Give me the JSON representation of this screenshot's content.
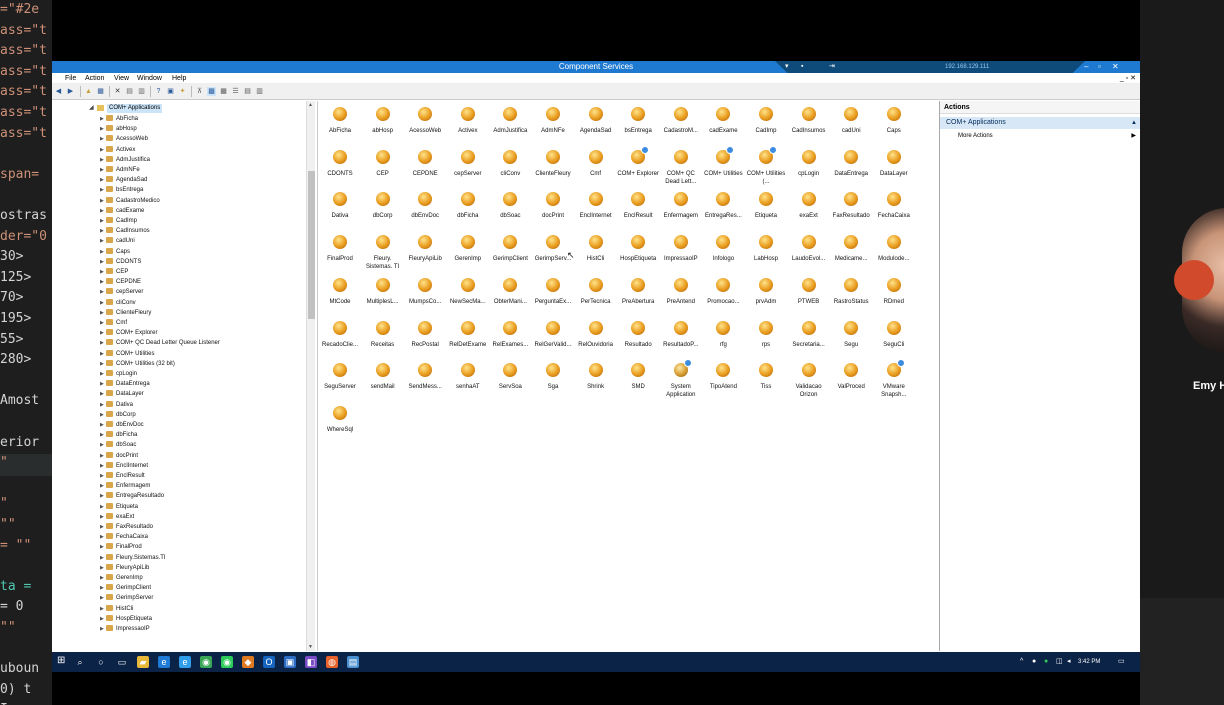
{
  "code_editor": {
    "lines": [
      {
        "text": "=\"#2e",
        "color": "#ce9178"
      },
      {
        "text": "ass=\"t",
        "color": "#ce9178"
      },
      {
        "text": "ass=\"t",
        "color": "#ce9178"
      },
      {
        "text": "ass=\"t",
        "color": "#ce9178"
      },
      {
        "text": "ass=\"t",
        "color": "#ce9178"
      },
      {
        "text": "ass=\"t",
        "color": "#ce9178"
      },
      {
        "text": "ass=\"t",
        "color": "#ce9178"
      },
      {
        "text": "",
        "color": "#d4d4d4"
      },
      {
        "text": "span=",
        "color": "#ce9178"
      },
      {
        "text": "",
        "color": "#d4d4d4"
      },
      {
        "text": "ostras",
        "color": "#d4d4d4"
      },
      {
        "text": "der=\"0",
        "color": "#ce9178"
      },
      {
        "text": "30>",
        "color": "#d4d4d4"
      },
      {
        "text": "125>",
        "color": "#d4d4d4"
      },
      {
        "text": "70>",
        "color": "#d4d4d4"
      },
      {
        "text": "195>",
        "color": "#d4d4d4"
      },
      {
        "text": "55>",
        "color": "#d4d4d4"
      },
      {
        "text": "280>",
        "color": "#d4d4d4"
      },
      {
        "text": "",
        "color": "#d4d4d4"
      },
      {
        "text": "Amost",
        "color": "#d4d4d4"
      },
      {
        "text": "",
        "color": "#d4d4d4"
      },
      {
        "text": "erior",
        "color": "#d4d4d4"
      },
      {
        "text": "\"",
        "color": "#ce9178"
      },
      {
        "text": "",
        "color": "#d4d4d4"
      },
      {
        "text": "\"",
        "color": "#ce9178"
      },
      {
        "text": " \"\"",
        "color": "#ce9178"
      },
      {
        "text": " = \"\"",
        "color": "#ce9178"
      },
      {
        "text": "",
        "color": "#d4d4d4"
      },
      {
        "text": "ta =",
        "color": "#4ec9b0"
      },
      {
        "text": "= 0",
        "color": "#d4d4d4"
      },
      {
        "text": "\"\"",
        "color": "#ce9178"
      },
      {
        "text": "",
        "color": "#d4d4d4"
      },
      {
        "text": "uboun",
        "color": "#d4d4d4"
      },
      {
        "text": " 0) t",
        "color": "#d4d4d4"
      },
      {
        "text": "I",
        "color": "#d4d4d4"
      }
    ]
  },
  "participant": {
    "name": "Emy H"
  },
  "window": {
    "title": "Component Services",
    "connection_ip": "192.168.129.111",
    "menu": [
      "File",
      "Action",
      "View",
      "Window",
      "Help"
    ]
  },
  "tree": {
    "root": "COM+ Applications",
    "items": [
      "AbFicha",
      "abHosp",
      "AcessoWeb",
      "Activex",
      "AdmJustifica",
      "AdmNFe",
      "AgendaSad",
      "bsEntrega",
      "CadastroMedico",
      "cadExame",
      "CadImp",
      "CadInsumos",
      "cadUni",
      "Caps",
      "CDONTS",
      "CEP",
      "CEPDNE",
      "cepServer",
      "cliConv",
      "ClienteFleury",
      "Cmf",
      "COM+ Explorer",
      "COM+ QC Dead Letter Queue Listener",
      "COM+ Utilities",
      "COM+ Utilities (32 bit)",
      "cpLogin",
      "DataEntrega",
      "DataLayer",
      "Dativa",
      "dbCorp",
      "dbEnvDoc",
      "dbFicha",
      "dbSoac",
      "docPrint",
      "EnclInternet",
      "EnclResult",
      "Enfermagem",
      "EntregaResultado",
      "Etiqueta",
      "exaExt",
      "FaxResultado",
      "FechaCaixa",
      "FinalProd",
      "Fleury.Sistemas.TI",
      "FleuryApiLib",
      "GerenImp",
      "GerimpClient",
      "GerimpServer",
      "HistCli",
      "HospEtiqueta",
      "ImpressaoIP"
    ]
  },
  "icons": [
    "AbFicha",
    "abHosp",
    "AcessoWeb",
    "Activex",
    "AdmJustifica",
    "AdmNFe",
    "AgendaSad",
    "bsEntrega",
    "CadastroM...",
    "cadExame",
    "CadImp",
    "CadInsumos",
    "cadUni",
    "Caps",
    "CDONTS",
    "CEP",
    "CEPDNE",
    "cepServer",
    "cliConv",
    "ClienteFleury",
    "Cmf",
    "COM+ Explorer",
    "COM+ QC Dead Lett...",
    "COM+ Utilities",
    "COM+ Utilities (...",
    "cpLogin",
    "DataEntrega",
    "DataLayer",
    "Dativa",
    "dbCorp",
    "dbEnvDoc",
    "dbFicha",
    "dbSoac",
    "docPrint",
    "EnclInternet",
    "EnclResult",
    "Enfermagem",
    "EntregaRes...",
    "Etiqueta",
    "exaExt",
    "FaxResultado",
    "FechaCaixa",
    "FinalProd",
    "Fleury. Sistemas. TI",
    "FleuryApiLib",
    "GerenImp",
    "GerimpClient",
    "GerimpServ...",
    "HistCli",
    "HospEtiqueta",
    "ImpressaoIP",
    "Infologo",
    "LabHosp",
    "LaudoEvol...",
    "Medicame...",
    "Modulode...",
    "MtCode",
    "MultiplesL...",
    "MumpsCo...",
    "NewSecMa...",
    "ObterMani...",
    "PerguntaEx...",
    "PerTecnica",
    "PreAbertura",
    "PreAntend",
    "Promocao...",
    "prvAdm",
    "PTWEB",
    "RastroStatus",
    "RDmed",
    "RecadoClie...",
    "Receitas",
    "RecPostal",
    "RelDetExame",
    "RelExames...",
    "RelGerValid...",
    "RelOuvidoria",
    "Resultado",
    "ResultadoP...",
    "rfg",
    "rps",
    "Secretaria...",
    "Segu",
    "SeguCli",
    "SeguServer",
    "sendMail",
    "SendMess...",
    "senhaAT",
    "ServSoa",
    "Sga",
    "Shrink",
    "SMD",
    "System Application",
    "TipoAtend",
    "Tiss",
    "Validacao Orizon",
    "ValProced",
    "VMware Snapsh...",
    "WhereSql"
  ],
  "badged_icons": [
    "COM+ Explorer",
    "COM+ Utilities",
    "COM+ Utilities (...",
    "System Application",
    "VMware Snapsh..."
  ],
  "actions": {
    "header": "Actions",
    "section": "COM+ Applications",
    "more": "More Actions"
  },
  "taskbar": {
    "clock": "3:42 PM",
    "apps": [
      {
        "name": "search-icon",
        "color": "#0b2347"
      },
      {
        "name": "cortana-icon",
        "color": "#0b2347"
      },
      {
        "name": "task-view-icon",
        "color": "#0b2347"
      },
      {
        "name": "file-explorer-icon",
        "color": "#e8b83a"
      },
      {
        "name": "edge-icon",
        "color": "#1f7ad6"
      },
      {
        "name": "ie-icon",
        "color": "#2f9de8"
      },
      {
        "name": "chrome-icon",
        "color": "#3aa757"
      },
      {
        "name": "whatsapp-icon",
        "color": "#2ecc5a"
      },
      {
        "name": "sql-icon",
        "color": "#e07a20"
      },
      {
        "name": "outlook-icon",
        "color": "#1565c0"
      },
      {
        "name": "remote-desktop-icon",
        "color": "#2c6cc4"
      },
      {
        "name": "visual-studio-icon",
        "color": "#7a4bc6"
      },
      {
        "name": "firefox-icon",
        "color": "#e8622a"
      },
      {
        "name": "mstsc-icon",
        "color": "#4a90d0"
      }
    ]
  }
}
